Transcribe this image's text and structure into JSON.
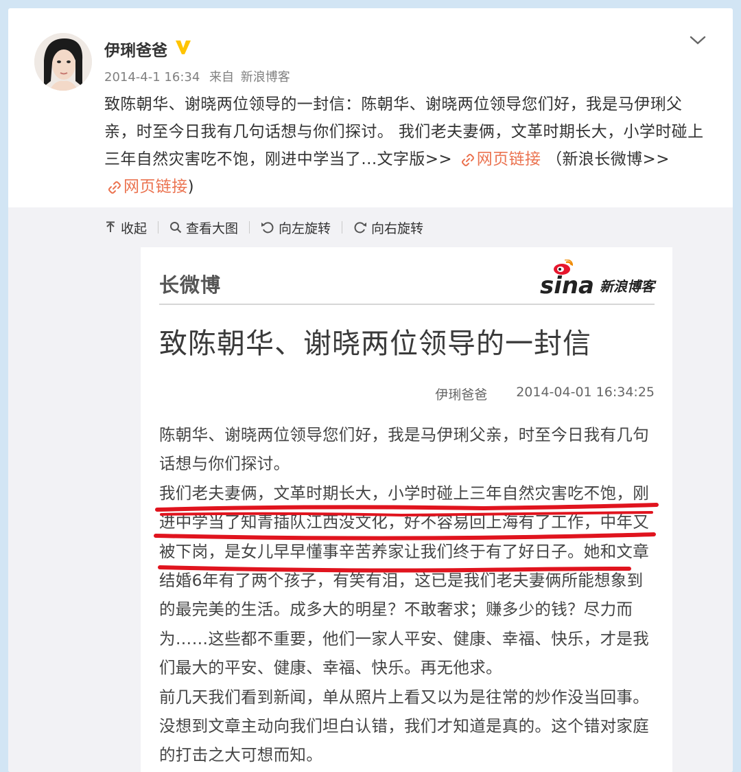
{
  "post": {
    "username": "伊琍爸爸",
    "timestamp": "2014-4-1 16:34",
    "source_prefix": "来自",
    "source": "新浪博客",
    "text_main": "致陈朝华、谢晓两位领导的一封信：陈朝华、谢晓两位领导您们好，我是马伊琍父亲，时至今日我有几句话想与你们探讨。 我们老夫妻俩，文革时期长大，小学时碰上三年自然灾害吃不饱，刚进中学当了...文字版>>",
    "link1_label": "网页链接",
    "text_mid": "（新浪长微博>>",
    "link2_label": "网页链接",
    "text_end": ")"
  },
  "toolbar": {
    "collapse": "收起",
    "view_large": "查看大图",
    "rotate_left": "向左旋转",
    "rotate_right": "向右旋转"
  },
  "doc": {
    "brand": "长微博",
    "logo_word": "sina",
    "logo_tag": "新浪博客",
    "title": "致陈朝华、谢晓两位领导的一封信",
    "author": "伊琍爸爸",
    "datetime": "2014-04-01 16:34:25",
    "paragraph1": "陈朝华、谢晓两位领导您们好，我是马伊琍父亲，时至今日我有几句话想与你们探讨。",
    "paragraph2": "我们老夫妻俩，文革时期长大，小学时碰上三年自然灾害吃不饱，刚进中学当了知青插队江西没文化，好不容易回上海有了工作，中年又被下岗，是女儿早早懂事辛苦养家让我们终于有了好日子。她和文章结婚6年有了两个孩子，有笑有泪，这已是我们老夫妻俩所能想象到的最完美的生活。成多大的明星？不敢奢求；赚多少的钱？尽力而为……这些都不重要，他们一家人平安、健康、幸福、快乐，才是我们最大的平安、健康、幸福、快乐。再无他求。",
    "paragraph3": "前几天我们看到新闻，单从照片上看又以为是往常的炒作没当回事。没想到文章主动向我们坦白认错，我们才知道是真的。这个错对家庭的打击之大可想而知。"
  },
  "colors": {
    "link": "#eb7350",
    "underline": "#e0141e",
    "verified": "#ffc400",
    "page_bg": "#d2e5f4"
  },
  "icons": [
    "avatar-photo",
    "verified-v-icon",
    "chevron-down-icon",
    "link-icon",
    "collapse-icon",
    "search-icon",
    "rotate-left-icon",
    "rotate-right-icon",
    "sina-eye-logo"
  ]
}
